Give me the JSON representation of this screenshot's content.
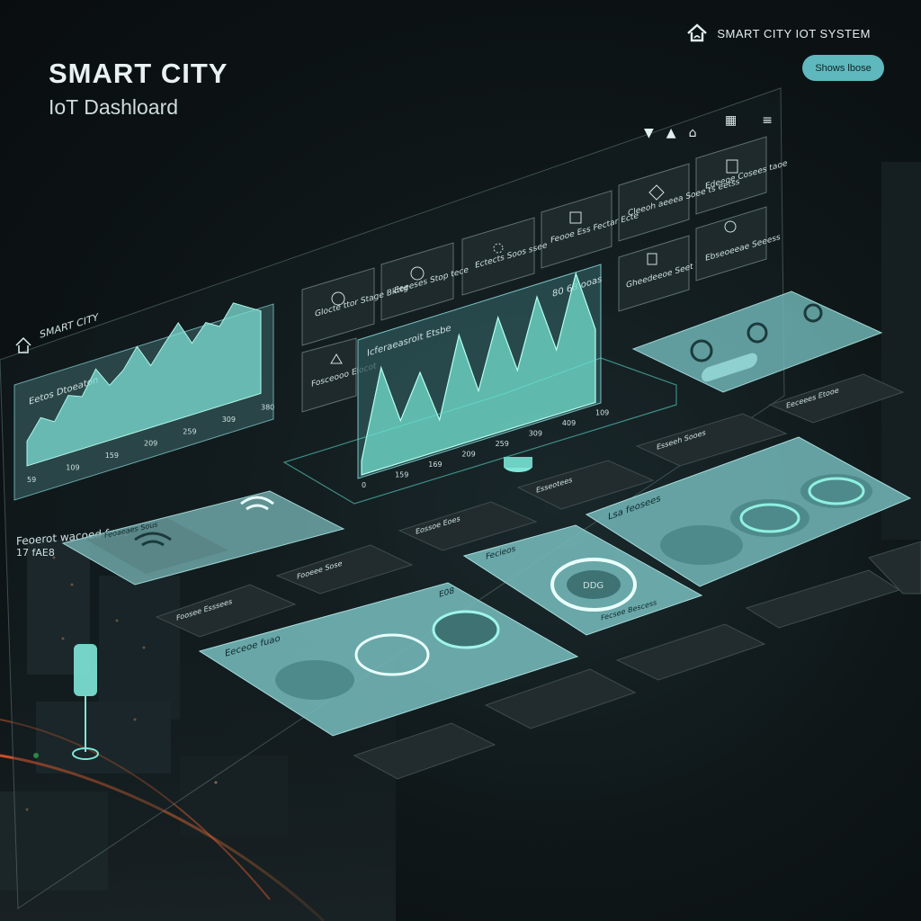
{
  "header": {
    "title": "SMART CITY",
    "subtitle": "IoT Dashloard",
    "brand": "SMART CITY IOT SYSTEM",
    "brand_icon": "home-icon",
    "action_button": "Shows lbose"
  },
  "board": {
    "left_panel_label": "SMART CITY",
    "left_chart_title": "Eetos Dtoeaton",
    "left_chart_ticks": [
      "59",
      "109",
      "159",
      "209",
      "259",
      "309",
      "380"
    ],
    "center_chart_title": "Icferaeasroit Etsbe",
    "center_chart_top_label": "80 68 ooas",
    "center_chart_ticks": [
      "0",
      "159",
      "169",
      "209",
      "259",
      "309",
      "409",
      "109"
    ],
    "side_label": "Feoerot wacoed foae",
    "side_value": "17 fAE8",
    "tiles_top": [
      {
        "label": "Glocte ttor Stage Bkttg",
        "icon": "pulse-icon"
      },
      {
        "label": "Eeeeses Stop tece",
        "icon": "gauge-icon"
      },
      {
        "label": "Ectects Soos ssee",
        "icon": "dots-icon"
      },
      {
        "label": "Feooe Ess Fectar Ecte",
        "icon": "lock-icon"
      },
      {
        "label": "Cleeoh aeeea Soee ts eetss",
        "icon": "map-icon"
      },
      {
        "label": "Edeeoe Cosees taoe",
        "icon": "grid-icon"
      }
    ],
    "tiles_mid": [
      {
        "label": "Fosceooo Elocot",
        "icon": "tree-icon"
      },
      {
        "label": "Gheedeeoe Seet Taees",
        "icon": "building-icon"
      },
      {
        "label": "Ebseoeeae Seeess",
        "icon": "user-icon"
      }
    ],
    "wifi_card": {
      "title": "Feoaeaes Sous",
      "icon": "wifi-icon"
    },
    "ring_card": {
      "title": "Fecieos",
      "center": "DDG",
      "footer": "Fecsee Bescess"
    },
    "wide_card_right": {
      "title": "Lsa feosees"
    },
    "wide_card_left": {
      "title": "Eeceoe fuao",
      "badge": "E08"
    },
    "list_items": [
      "Eossoe Eoes",
      "Esseotees",
      "Fooeee Sose",
      "Foosee Esssees",
      "Esseeh Sooes",
      "Eeceees Etooe"
    ]
  },
  "chart_data": [
    {
      "type": "area",
      "title": "Eetos Dtoeaton",
      "x": [
        "59",
        "109",
        "159",
        "209",
        "259",
        "309",
        "380"
      ],
      "series": [
        {
          "values": [
            18,
            32,
            26,
            42,
            38,
            55,
            40,
            48,
            62,
            45,
            58,
            70,
            52,
            64,
            58,
            72,
            66,
            60
          ]
        }
      ]
    },
    {
      "type": "area",
      "title": "Icferaeasroit Etsbe",
      "x": [
        "0",
        "159",
        "169",
        "209",
        "259",
        "309",
        "409",
        "109"
      ],
      "series": [
        {
          "values": [
            10,
            72,
            30,
            60,
            22,
            78,
            34,
            82,
            40,
            88,
            46,
            96,
            52
          ]
        }
      ]
    }
  ],
  "colors": {
    "accent": "#5fb8bd",
    "panel_light": "#7cc3c4",
    "panel_dark": "#232e30",
    "background": "#0e1517"
  }
}
